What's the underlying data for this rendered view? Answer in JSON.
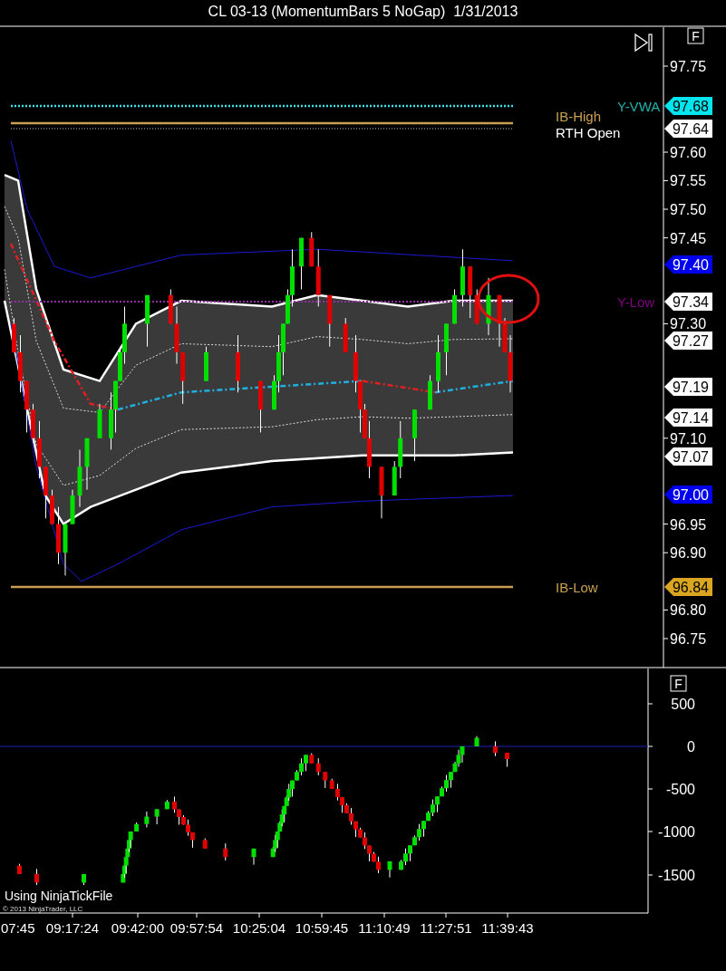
{
  "window": {
    "title": "CL 03-13 (MomentumBars 5 NoGap)  1/31/2013"
  },
  "price_panel": {
    "button": "F",
    "axis_ticks": [
      "97.75",
      "97.60",
      "97.55",
      "97.50",
      "97.45",
      "97.30",
      "97.10",
      "96.95",
      "96.90",
      "96.80",
      "96.75"
    ],
    "markers": [
      {
        "text": "97.68",
        "color": "#00e5ee"
      },
      {
        "text": "97.64",
        "color": "#ffffff"
      },
      {
        "text": "97.40",
        "color": "#0000ee"
      },
      {
        "text": "97.34",
        "color": "#ffffff"
      },
      {
        "text": "97.27",
        "color": "#ffffff"
      },
      {
        "text": "97.19",
        "color": "#ffffff"
      },
      {
        "text": "97.14",
        "color": "#ffffff"
      },
      {
        "text": "97.07",
        "color": "#ffffff"
      },
      {
        "text": "97.00",
        "color": "#0000ee"
      },
      {
        "text": "96.84",
        "color": "#daa520"
      }
    ],
    "line_labels": [
      {
        "text": "Y-VWA",
        "color": "#20b2aa"
      },
      {
        "text": "IB-High",
        "color": "#c8a050"
      },
      {
        "text": "RTH Open",
        "color": "#ffffff"
      },
      {
        "text": "Y-Low",
        "color": "#800080"
      },
      {
        "text": "IB-Low",
        "color": "#c8a050"
      }
    ]
  },
  "indicator_panel": {
    "button": "F",
    "axis_ticks": [
      "500",
      "0",
      "-500",
      "-1000",
      "-1500"
    ],
    "notes": [
      "Using NinjaTickFile",
      "© 2013 NinjaTrader, LLC"
    ]
  },
  "time_axis": [
    "07:45",
    "09:17:24",
    "09:42:00",
    "09:57:54",
    "10:25:04",
    "10:59:45",
    "11:10:49",
    "11:27:51",
    "11:39:43"
  ]
}
